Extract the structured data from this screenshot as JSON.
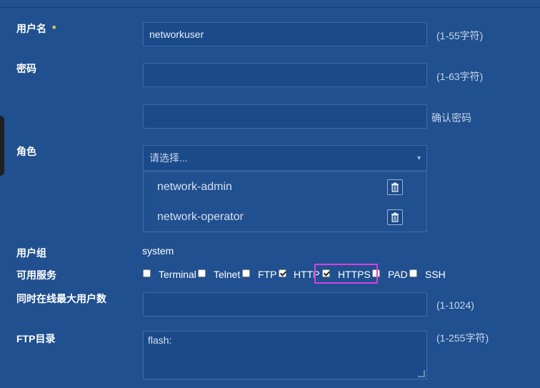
{
  "form": {
    "username": {
      "label": "用户名",
      "required": "*",
      "value": "networkuser",
      "hint": "(1-55字符)"
    },
    "password": {
      "label": "密码",
      "value": "",
      "hint": "(1-63字符)"
    },
    "confirm_password": {
      "value": "",
      "hint": "确认密码"
    },
    "role": {
      "label": "角色",
      "placeholder": "请选择...",
      "selected_roles": [
        "network-admin",
        "network-operator"
      ]
    },
    "user_group": {
      "label": "用户组",
      "value": "system"
    },
    "services": {
      "label": "可用服务",
      "items": [
        {
          "label": "Terminal",
          "checked": false
        },
        {
          "label": "Telnet",
          "checked": false
        },
        {
          "label": "FTP",
          "checked": false
        },
        {
          "label": "HTTP",
          "checked": true
        },
        {
          "label": "HTTPS",
          "checked": true
        },
        {
          "label": "PAD",
          "checked": false
        },
        {
          "label": "SSH",
          "checked": false
        }
      ]
    },
    "max_online": {
      "label": "同时在线最大用户数",
      "value": "",
      "hint": "(1-1024)"
    },
    "ftp_dir": {
      "label": "FTP目录",
      "value": "flash:",
      "hint": "(1-255字符)"
    }
  },
  "colors": {
    "background": "#20508f",
    "input": "#1b4a8a",
    "highlight": "#d93fe0",
    "required": "#ffe24a"
  }
}
